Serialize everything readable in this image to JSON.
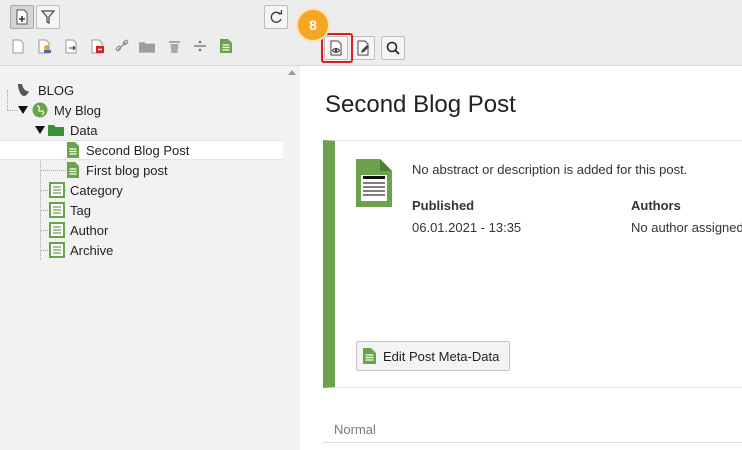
{
  "left_toolbar": {
    "new_button_icon": "new-page-icon",
    "filter_button_icon": "filter-icon",
    "refresh_icon": "refresh-icon",
    "page_icons": [
      "page-new-icon",
      "page-user-icon",
      "page-move-icon",
      "page-delete-icon",
      "link-icon",
      "folder-icon",
      "trash-icon",
      "divider-icon",
      "page-doc-icon"
    ]
  },
  "tree": {
    "root_label": "BLOG",
    "items": [
      {
        "label": "My Blog"
      },
      {
        "label": "Data"
      },
      {
        "label": "Second Blog Post"
      },
      {
        "label": "First blog post"
      },
      {
        "label": "Category"
      },
      {
        "label": "Tag"
      },
      {
        "label": "Author"
      },
      {
        "label": "Archive"
      }
    ]
  },
  "annotation": {
    "step_badge": "8"
  },
  "right_toolbar": {
    "buttons": [
      "view-page-icon",
      "edit-page-icon",
      "search-icon"
    ]
  },
  "content": {
    "title": "Second Blog Post",
    "abstract": "No abstract or description is added for this post.",
    "published_label": "Published",
    "published_value": "06.01.2021 - 13:35",
    "authors_label": "Authors",
    "authors_value": "No author assigned",
    "edit_button_label": "Edit Post Meta-Data",
    "normal_label": "Normal"
  },
  "colors": {
    "accent_green": "#6ba24c",
    "badge_orange": "#f5a623",
    "highlight_red": "#d91f1f"
  }
}
